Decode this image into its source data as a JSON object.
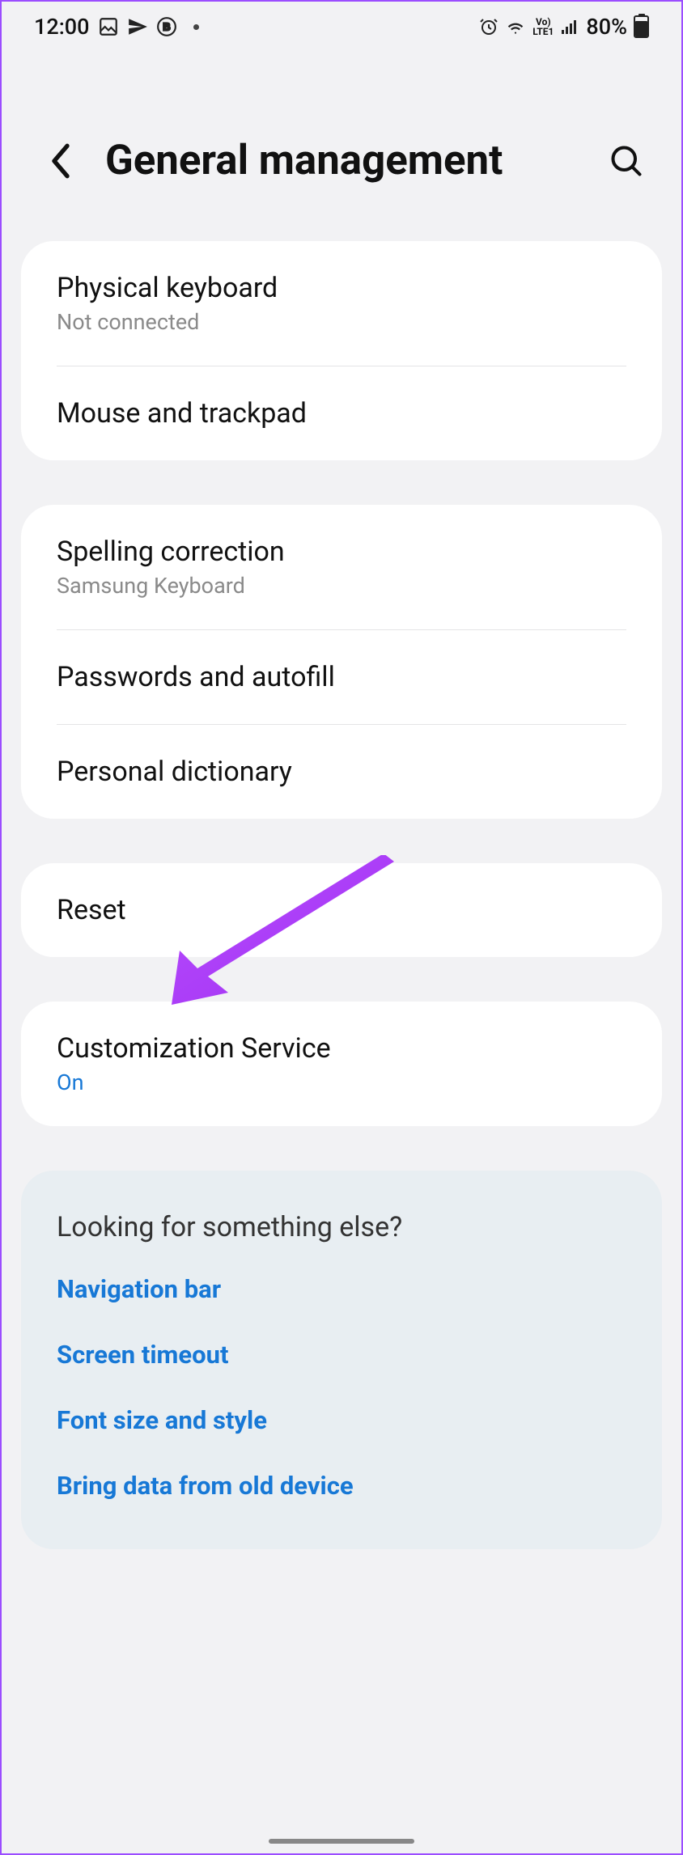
{
  "status": {
    "time": "12:00",
    "battery_pct": "80%"
  },
  "header": {
    "title": "General management"
  },
  "groups": [
    {
      "items": [
        {
          "title": "Physical keyboard",
          "subtitle": "Not connected"
        },
        {
          "title": "Mouse and trackpad"
        }
      ]
    },
    {
      "items": [
        {
          "title": "Spelling correction",
          "subtitle": "Samsung Keyboard"
        },
        {
          "title": "Passwords and autofill"
        },
        {
          "title": "Personal dictionary"
        }
      ]
    },
    {
      "items": [
        {
          "title": "Reset"
        }
      ]
    },
    {
      "items": [
        {
          "title": "Customization Service",
          "subtitle_link": "On"
        }
      ]
    }
  ],
  "suggestions": {
    "title": "Looking for something else?",
    "links": [
      "Navigation bar",
      "Screen timeout",
      "Font size and style",
      "Bring data from old device"
    ]
  }
}
